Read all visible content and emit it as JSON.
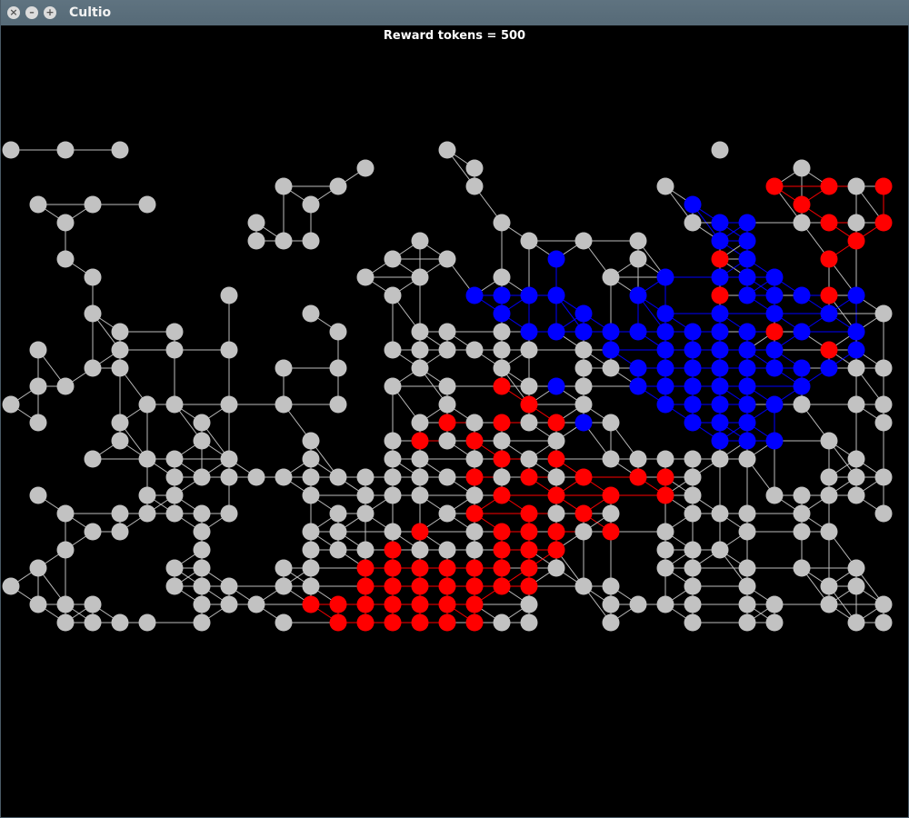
{
  "window": {
    "title": "Cultio",
    "buttons": [
      {
        "name": "close-icon",
        "glyph": "×"
      },
      {
        "name": "minimize-icon",
        "glyph": "–"
      },
      {
        "name": "maximize-icon",
        "glyph": "+"
      }
    ]
  },
  "hud": {
    "reward_text": "Reward tokens = 500"
  },
  "colors": {
    "neutral": "#c2c2c2",
    "player": "#ff0000",
    "enemy": "#0000ff"
  }
}
